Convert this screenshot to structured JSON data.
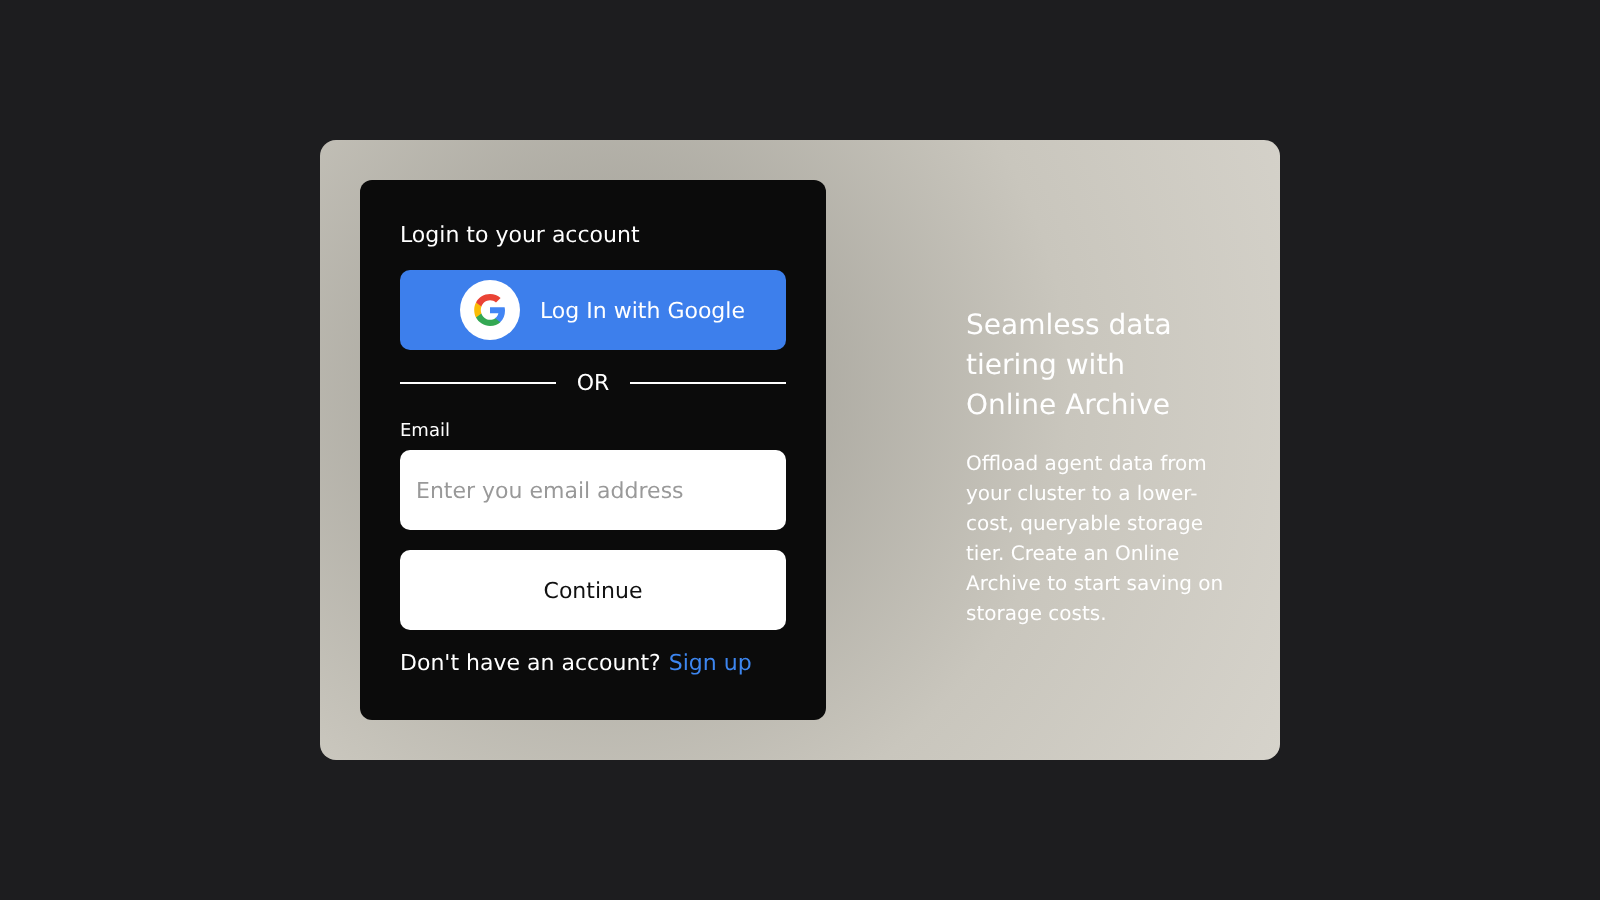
{
  "card": {
    "title": "Login to your account",
    "google_button": "Log In with Google",
    "divider": "OR",
    "email": {
      "label": "Email",
      "placeholder": "Enter you email address"
    },
    "continue_button": "Continue",
    "signup": {
      "prompt": "Don't have an account?",
      "link": "Sign up"
    }
  },
  "promo": {
    "heading": "Seamless data tiering with Online Archive",
    "body": "Offload agent data from your cluster to a lower-cost, queryable storage tier. Create an Online Archive to start saving on storage costs."
  }
}
